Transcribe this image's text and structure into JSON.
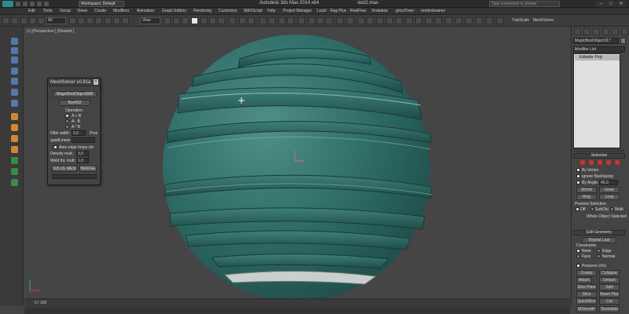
{
  "window": {
    "title": "Autodesk 3ds Max  2014 x64",
    "file": "test2.max",
    "workspace": "Workspace: Default",
    "search_placeholder": "Type a keyword or phrase",
    "buttons": [
      "–",
      "□",
      "✕"
    ]
  },
  "menu": [
    "Edit",
    "Tools",
    "Group",
    "Views",
    "Create",
    "Modifiers",
    "Animation",
    "Graph Editors",
    "Rendering",
    "Customize",
    "MAXScript",
    "Help",
    "Project Manager",
    "Lucid",
    "Rag Plus",
    "RealFlow",
    "Krakatoa",
    "ghostTown",
    "renderbeamer"
  ],
  "toolbar": {
    "filter_value": "All",
    "view_value": "View",
    "tools": [
      "TriplScale",
      "MeshSolver"
    ]
  },
  "viewport": {
    "label": "[+] [Perspective ] [Shaded ]",
    "object_color": "#2e6b66"
  },
  "meshsolver": {
    "title": "MeshSolver v0.81a",
    "object_button": "MagicBoolObject008",
    "second_object": "Box002",
    "operation_label": "Operation:",
    "ops": [
      "A + B",
      "A - B",
      "A * B"
    ],
    "fillet_label": "Fillet width:",
    "fillet_value": "6,0",
    "fillet_unit": "Pres",
    "quadlinear_label": "quadLinear:",
    "auto_edge_label": "Auto edge loops ctrl",
    "density_label": "Density mult.:",
    "density_value": "3,0",
    "weld_label": "Weld thr. mult.:",
    "weld_value": "1,0",
    "solve_button": "SOLVE MESH",
    "bridge_button": "BRIDGE"
  },
  "command_panel": {
    "object_name": "MagicBoolObject117",
    "modifier_list": "Modifier List",
    "stack_item": "Editable Poly",
    "selection": "Selection",
    "by_vertex": "By Vertex",
    "ignore_backfacing": "Ignore Backfacing",
    "by_angle": "By Angle:",
    "by_angle_value": "45,0",
    "shrink": "Shrink",
    "grow": "Grow",
    "ring": "Ring",
    "loop": "Loop",
    "preview_selection": "Preview Selection",
    "off": "Off",
    "subobj": "SubObj",
    "multi": "Multi",
    "whole_object": "Whole Object Selected",
    "edit_geometry": "Edit Geometry",
    "repeat_last": "Repeat Last",
    "constraints": "Constraints",
    "none": "None",
    "edge": "Edge",
    "face": "Face",
    "normal": "Normal",
    "preserve_uvs": "Preserve UVs",
    "create": "Create",
    "collapse": "Collapse",
    "attach": "Attach",
    "detach": "Detach",
    "slice_plane": "Slice Plane",
    "split": "Split",
    "slice": "Slice",
    "reset_plane": "Reset Plane",
    "quickslice": "QuickSlice",
    "cut": "Cut",
    "msmooth": "MSmooth",
    "tessellate": "Tessellate"
  },
  "timeline": {
    "frame": "0 / 100"
  }
}
